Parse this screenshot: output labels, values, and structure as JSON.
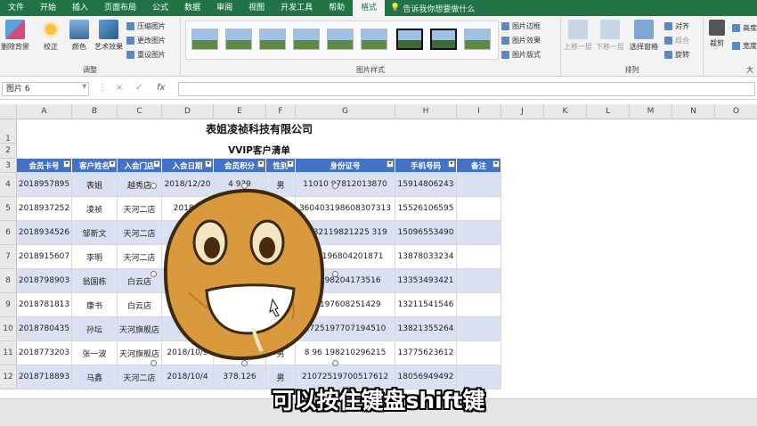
{
  "ribbon": {
    "tabs": [
      "文件",
      "开始",
      "插入",
      "页面布局",
      "公式",
      "数据",
      "审阅",
      "视图",
      "开发工具",
      "帮助",
      "格式"
    ],
    "active_tab": "格式",
    "tell_me": "告诉我你想要做什么",
    "adjust_group": {
      "title": "调整",
      "remove_bg": "删除背景",
      "corrections": "校正",
      "color": "颜色",
      "artistic": "艺术效果",
      "compress": "压缩图片",
      "change": "更改图片",
      "reset": "重设图片"
    },
    "styles_group": {
      "title": "图片样式",
      "border": "图片边框",
      "effects": "图片效果",
      "layout": "图片版式"
    },
    "arrange_group": {
      "title": "排列",
      "bring_forward": "上移一层",
      "send_backward": "下移一层",
      "selection_pane": "选择窗格",
      "align": "对齐",
      "group": "组合",
      "rotate": "旋转"
    },
    "size_group": {
      "crop": "裁剪",
      "height": "高度",
      "width": "宽度",
      "title": "大"
    }
  },
  "formula_bar": {
    "name_box": "图片 6",
    "fx": "fx",
    "cancel": "×",
    "confirm": "✓",
    "value": ""
  },
  "sheet": {
    "columns": [
      "A",
      "B",
      "C",
      "D",
      "E",
      "F",
      "G",
      "H",
      "I",
      "J",
      "K",
      "L",
      "M",
      "N",
      "O"
    ],
    "title": "表姐凌祯科技有限公司",
    "subtitle": "VVIP客户清单",
    "headers": [
      "会员卡号",
      "客户姓名",
      "入会门店",
      "入会日期",
      "会员积分",
      "性别",
      "身份证号",
      "手机号码",
      "备注"
    ],
    "rows": [
      {
        "num": "4",
        "cells": [
          "2018957895",
          "表姐",
          "越秀店",
          "2018/12/20",
          "4 939",
          "男",
          "11010 97812013870",
          "15914806243",
          ""
        ]
      },
      {
        "num": "5",
        "cells": [
          "2018937252",
          "凌祯",
          "天河二店",
          "2018/1",
          "",
          "",
          "360403198608307313",
          "15526106595",
          ""
        ]
      },
      {
        "num": "6",
        "cells": [
          "2018934526",
          "邹新文",
          "天河二店",
          "20",
          "",
          "",
          "3232119821225 319",
          "15096553490",
          ""
        ]
      },
      {
        "num": "7",
        "cells": [
          "2018915607",
          "李明",
          "天河二店",
          "",
          "",
          "",
          "102196804201871",
          "13878033234",
          ""
        ]
      },
      {
        "num": "8",
        "cells": [
          "2018798903",
          "翁国栋",
          "白云店",
          "",
          "",
          "",
          "08198204173516",
          "13353493421",
          ""
        ]
      },
      {
        "num": "9",
        "cells": [
          "2018781813",
          "康书",
          "白云店",
          "",
          "",
          "",
          "05197608251429",
          "13211541546",
          ""
        ]
      },
      {
        "num": "10",
        "cells": [
          "2018780435",
          "孙坛",
          "天河旗舰店",
          "",
          "",
          "",
          "2725197707194510",
          "13821355264",
          ""
        ]
      },
      {
        "num": "11",
        "cells": [
          "2018773203",
          "张一波",
          "天河旗舰店",
          "2018/10/9",
          "",
          "男",
          "8 96 198210296215",
          "13775623612",
          ""
        ]
      },
      {
        "num": "12",
        "cells": [
          "2018718893",
          "马鑫",
          "天河二店",
          "2018/10/4",
          "378.126",
          "男",
          "21072519700517612",
          "18056949492",
          ""
        ]
      }
    ]
  },
  "subtitle_caption": "可以按住键盘shift键",
  "colors": {
    "excel_green": "#217346",
    "header_blue": "#4472c4",
    "band_blue": "#d9e1f2",
    "potato_body": "#d99a3e",
    "potato_outline": "#3b2a10"
  }
}
